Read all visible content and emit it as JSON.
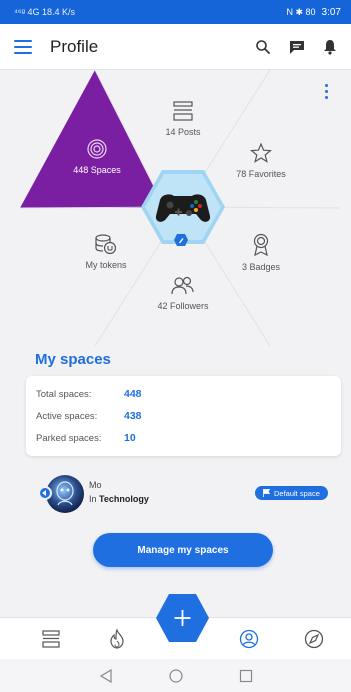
{
  "status_bar": {
    "left": "⁴⁶ᵍ 4G 18.4 K/s",
    "right": "N ✱ 80",
    "time": "3:07"
  },
  "header": {
    "title": "Profile"
  },
  "profile": {
    "stats": {
      "spaces": "448 Spaces",
      "posts": "14 Posts",
      "favorites": "78 Favorites",
      "badges": "3 Badges",
      "followers": "42 Followers",
      "tokens": "My tokens"
    },
    "accent": "#1f6fe0",
    "spaces_color": "#7b1fa2"
  },
  "my_spaces": {
    "title": "My spaces",
    "rows": [
      {
        "label": "Total spaces:",
        "value": "448"
      },
      {
        "label": "Active spaces:",
        "value": "438"
      },
      {
        "label": "Parked spaces:",
        "value": "10"
      }
    ]
  },
  "space_item": {
    "name": "Mo",
    "category_prefix": "In",
    "category": "Technology",
    "badge": "Default space"
  },
  "manage_button": "Manage my spaces",
  "bottom_nav": {
    "icons": [
      "feed-icon",
      "fire-icon",
      "add-icon",
      "profile-icon",
      "compass-icon"
    ],
    "active": "profile-icon"
  }
}
